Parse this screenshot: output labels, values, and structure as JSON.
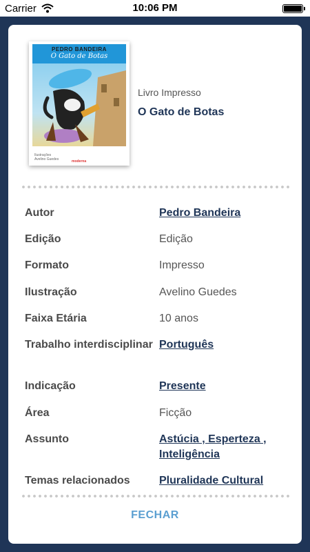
{
  "status_bar": {
    "carrier": "Carrier",
    "time": "10:06 PM"
  },
  "book": {
    "type": "Livro Impresso",
    "title": "O Gato de Botas",
    "cover": {
      "author": "PEDRO BANDEIRA",
      "title": "O Gato de Botas",
      "credit_line1": "Ilustrações",
      "credit_line2": "Avelino Guedes",
      "publisher": "moderna"
    }
  },
  "details": [
    {
      "label": "Autor",
      "value": "Pedro Bandeira",
      "link": true
    },
    {
      "label": "Edição",
      "value": "Edição",
      "link": false
    },
    {
      "label": "Formato",
      "value": "Impresso",
      "link": false
    },
    {
      "label": "Ilustração",
      "value": "Avelino Guedes",
      "link": false
    },
    {
      "label": "Faixa Etária",
      "value": "10 anos",
      "link": false
    },
    {
      "label": "Trabalho interdisciplinar",
      "value": "Português",
      "link": true
    },
    {
      "label": "Indicação",
      "value": "Presente",
      "link": true
    },
    {
      "label": "Área",
      "value": "Ficção",
      "link": false
    },
    {
      "label": "Assunto",
      "value": "Astúcia , Esperteza , Inteligência",
      "link": true
    },
    {
      "label": "Temas relacionados",
      "value": "Pluralidade Cultural",
      "link": true
    }
  ],
  "actions": {
    "close_label": "FECHAR"
  },
  "colors": {
    "navy": "#1f3557",
    "accent": "#5b9fd1",
    "cover_band": "#2196d8"
  }
}
